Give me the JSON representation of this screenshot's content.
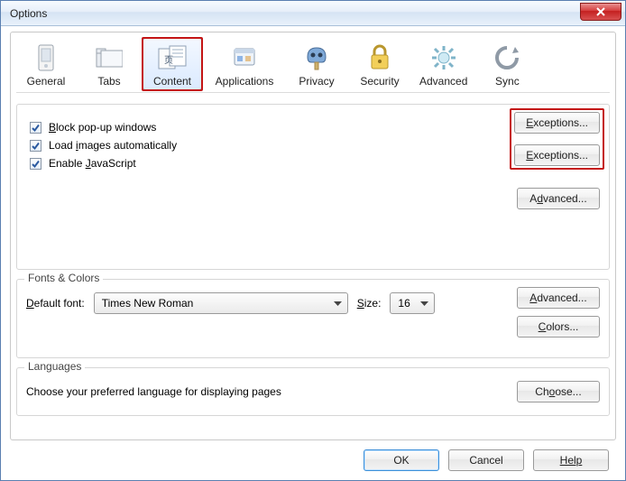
{
  "window": {
    "title": "Options"
  },
  "tabs": {
    "general": "General",
    "tabs": "Tabs",
    "content": "Content",
    "applications": "Applications",
    "privacy": "Privacy",
    "security": "Security",
    "advanced": "Advanced",
    "sync": "Sync",
    "selected": "content"
  },
  "content_section": {
    "block_popups": {
      "label": "Block pop-up windows",
      "checked": true,
      "accessKey": "B"
    },
    "load_images": {
      "label": "Load images automatically",
      "checked": true,
      "accessKey": "i"
    },
    "enable_js": {
      "label": "Enable JavaScript",
      "checked": true,
      "accessKey": "J"
    },
    "exceptions_label": "Exceptions...",
    "advanced_label": "Advanced..."
  },
  "fonts": {
    "legend": "Fonts & Colors",
    "default_font_label": "Default font:",
    "default_font_value": "Times New Roman",
    "size_label": "Size:",
    "size_value": "16",
    "advanced_label": "Advanced...",
    "colors_label": "Colors..."
  },
  "languages": {
    "legend": "Languages",
    "desc": "Choose your preferred language for displaying pages",
    "choose_label": "Choose..."
  },
  "buttons": {
    "ok": "OK",
    "cancel": "Cancel",
    "help": "Help"
  },
  "colors": {
    "highlight_red": "#c41515",
    "selection_border": "#7aa7d8"
  }
}
